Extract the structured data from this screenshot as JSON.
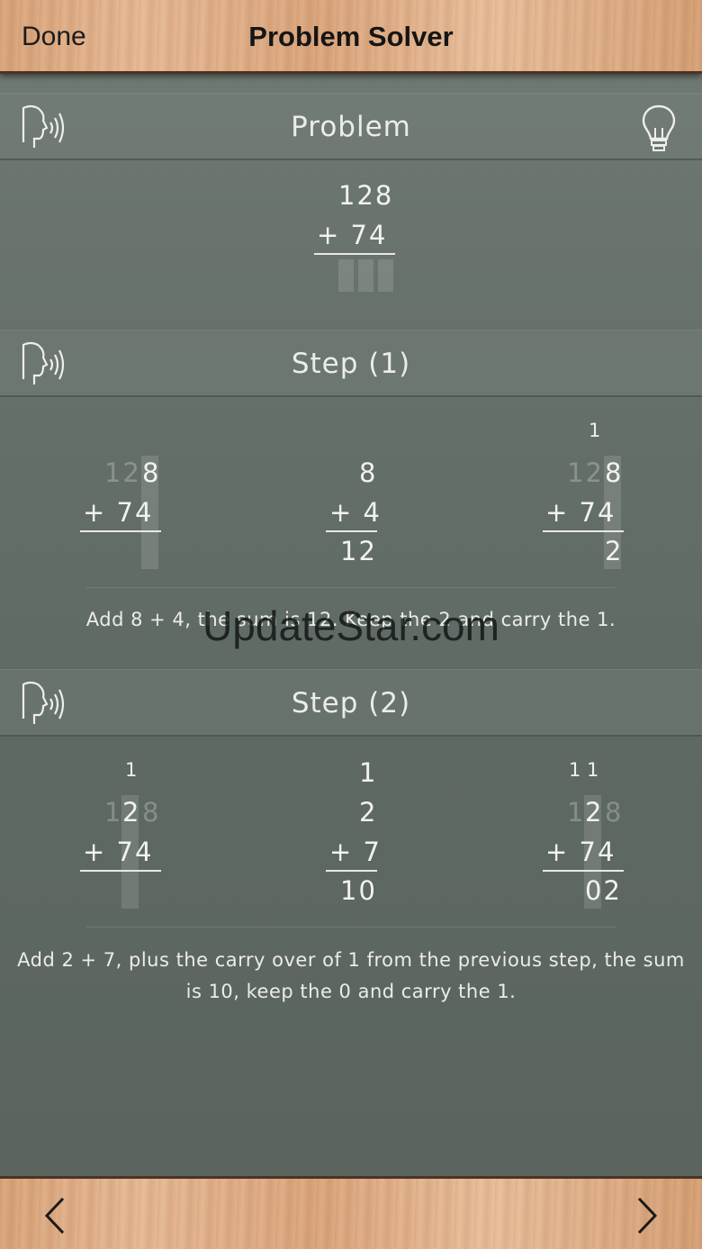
{
  "nav": {
    "done_label": "Done",
    "title": "Problem Solver"
  },
  "problem": {
    "header": "Problem",
    "top": "128",
    "bottom": "+ 74"
  },
  "step1": {
    "header": "Step (1)",
    "col1": {
      "top_faint": "12",
      "top_bold": "8",
      "bottom": "+ 74"
    },
    "col2": {
      "top": "8",
      "bottom": "+ 4",
      "result": "12"
    },
    "col3": {
      "carry": "1",
      "top_faint": "12",
      "top_bold": "8",
      "bottom": "+ 74",
      "result": "2"
    },
    "explanation": "Add 8 + 4, the sum is 12. Keep the 2 and carry the 1."
  },
  "step2": {
    "header": "Step (2)",
    "col1": {
      "carry": "1",
      "top_faint_left": "1",
      "top_bold": "2",
      "top_faint_right": "8",
      "bottom": "+ 74"
    },
    "col2": {
      "carry": "1",
      "top": "2",
      "bottom": "+ 7",
      "result": "10"
    },
    "col3": {
      "carry": "1 1",
      "top_faint_left": "1",
      "top_bold": "2",
      "top_faint_right": "8",
      "bottom": "+ 74",
      "result": "02"
    },
    "explanation_line1": "Add 2 + 7, plus the carry over of 1 from the previous step, the sum",
    "explanation_line2": "is 10, keep the 0 and carry the 1."
  },
  "watermark": "UpdateStar.com",
  "icons": {
    "speak": "speaker-head-icon",
    "hint": "lightbulb-icon",
    "prev": "chevron-left-icon",
    "next": "chevron-right-icon"
  }
}
